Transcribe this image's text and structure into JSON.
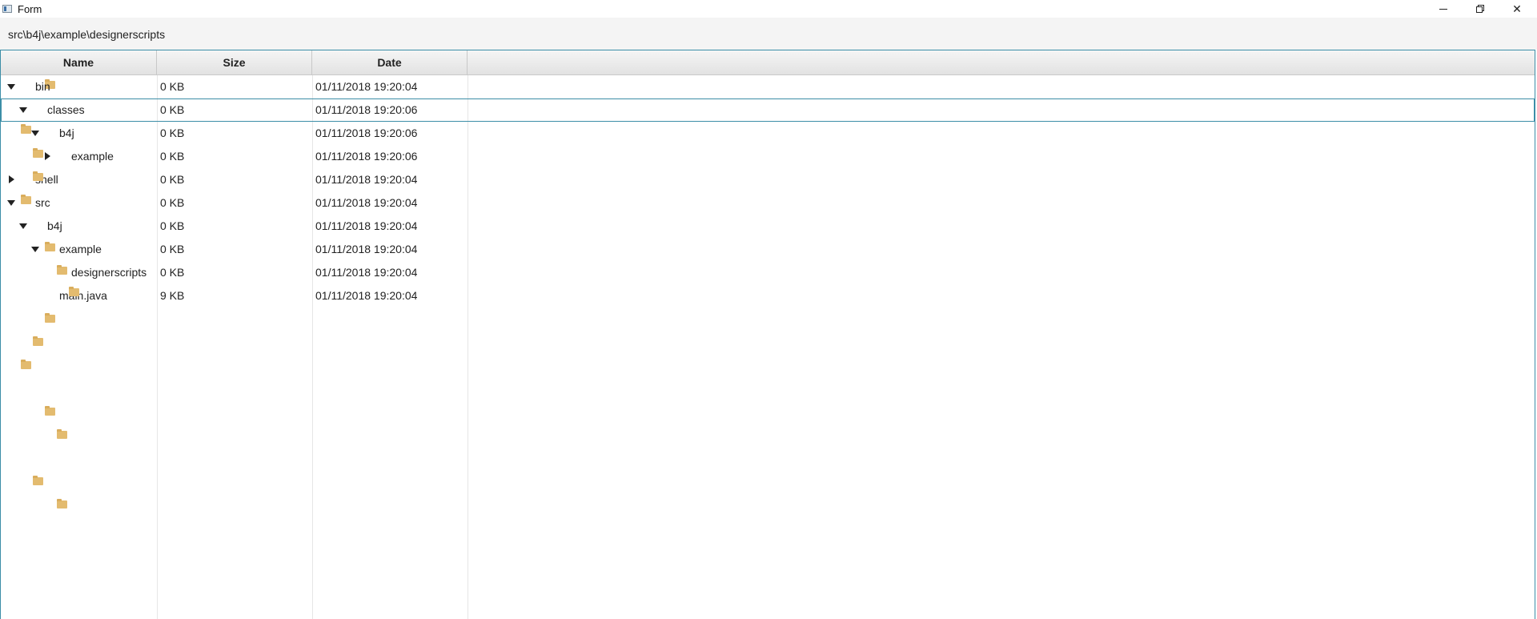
{
  "window": {
    "title": "Form",
    "minimize_icon": "minimize-icon",
    "maximize_icon": "restore-icon",
    "close_icon": "close-icon",
    "close_glyph": "✕"
  },
  "path": "src\\b4j\\example\\designerscripts",
  "columns": {
    "name": "Name",
    "size": "Size",
    "date": "Date"
  },
  "rows": [
    {
      "name": "bin",
      "size": "0 KB",
      "date": "01/11/2018 19:20:04",
      "arrow": "down",
      "selected": false
    },
    {
      "name": "classes",
      "size": "0 KB",
      "date": "01/11/2018 19:20:06",
      "arrow": "down",
      "selected": true
    },
    {
      "name": "b4j",
      "size": "0 KB",
      "date": "01/11/2018 19:20:06",
      "arrow": "down",
      "selected": false
    },
    {
      "name": "example",
      "size": "0 KB",
      "date": "01/11/2018 19:20:06",
      "arrow": "right",
      "selected": false
    },
    {
      "name": "shell",
      "size": "0 KB",
      "date": "01/11/2018 19:20:04",
      "arrow": "right",
      "selected": false
    },
    {
      "name": "src",
      "size": "0 KB",
      "date": "01/11/2018 19:20:04",
      "arrow": "down",
      "selected": false
    },
    {
      "name": "b4j",
      "size": "0 KB",
      "date": "01/11/2018 19:20:04",
      "arrow": "down",
      "selected": false
    },
    {
      "name": "example",
      "size": "0 KB",
      "date": "01/11/2018 19:20:04",
      "arrow": "down",
      "selected": false
    },
    {
      "name": "designerscripts",
      "size": "0 KB",
      "date": "01/11/2018 19:20:04",
      "arrow": "none",
      "selected": false
    },
    {
      "name": "main.java",
      "size": "9 KB",
      "date": "01/11/2018 19:20:04",
      "arrow": "none",
      "selected": false
    }
  ],
  "colors": {
    "folder": "#e3bb6f",
    "accent_border": "#3c8ea7"
  }
}
